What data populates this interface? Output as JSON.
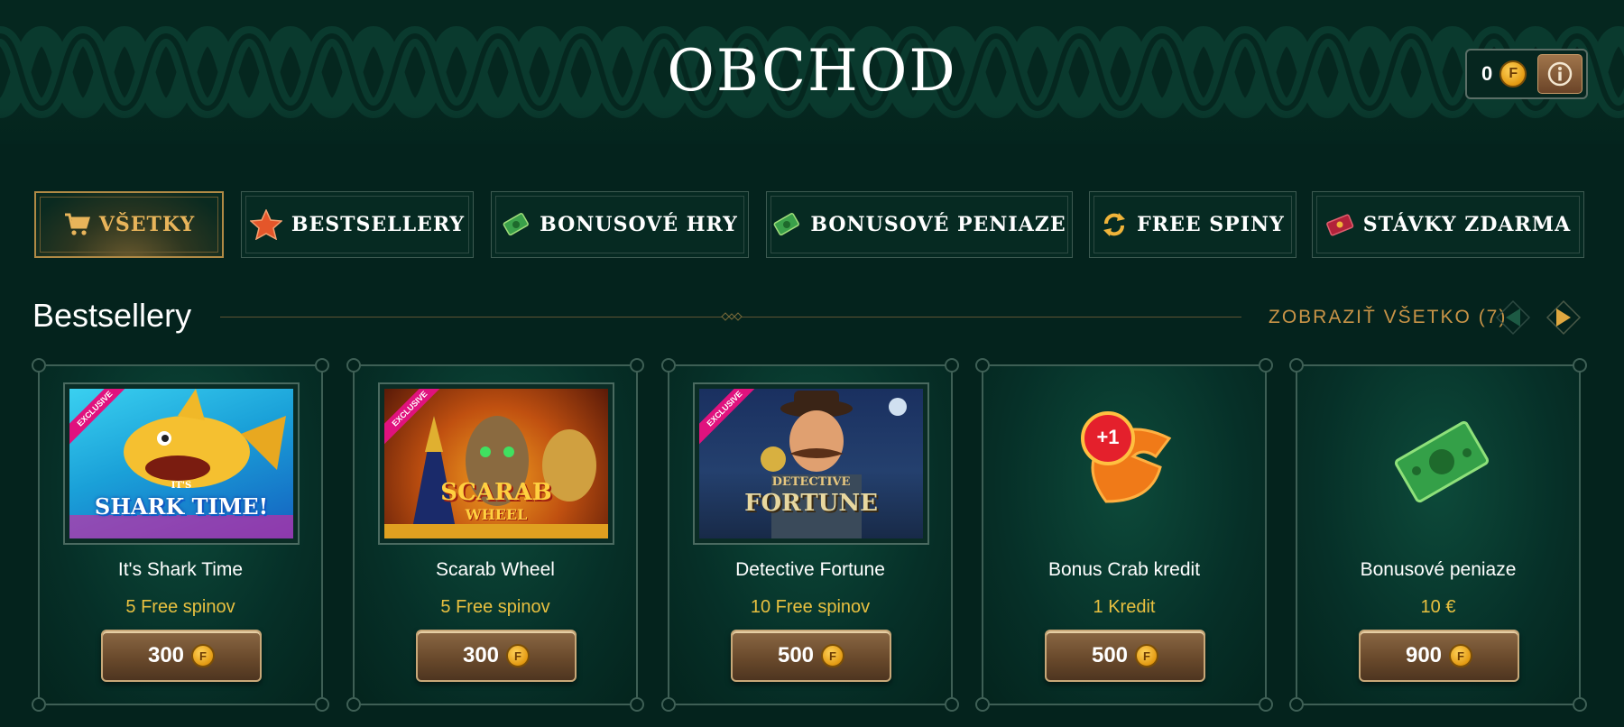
{
  "header": {
    "title": "OBCHOD",
    "balance": "0",
    "coin_symbol": "F"
  },
  "categories": [
    {
      "label": "VŠETKY",
      "icon": "cart-icon",
      "active": true
    },
    {
      "label": "BESTSELLERY",
      "icon": "star-icon",
      "active": false
    },
    {
      "label": "BONUSOVÉ HRY",
      "icon": "money-icon",
      "active": false
    },
    {
      "label": "BONUSOVÉ PENIAZE",
      "icon": "money-icon",
      "active": false
    },
    {
      "label": "FREE SPINY",
      "icon": "spin-arrows-icon",
      "active": false
    },
    {
      "label": "STÁVKY ZDARMA",
      "icon": "ticket-icon",
      "active": false
    }
  ],
  "section": {
    "title": "Bestsellery",
    "view_all": "ZOBRAZIŤ VŠETKO (7)"
  },
  "products": [
    {
      "name": "It's Shark Time",
      "subtitle": "5 Free spinov",
      "price": "300",
      "exclusive": "EXCLUSIVE",
      "image_text": "SHARK TIME!",
      "image_small": "IT'S"
    },
    {
      "name": "Scarab Wheel",
      "subtitle": "5 Free spinov",
      "price": "300",
      "exclusive": "EXCLUSIVE",
      "image_text": "SCARAB",
      "image_small": "WHEEL"
    },
    {
      "name": "Detective Fortune",
      "subtitle": "10 Free spinov",
      "price": "500",
      "exclusive": "EXCLUSIVE",
      "image_text": "FORTUNE",
      "image_small": "DETECTIVE"
    },
    {
      "name": "Bonus Crab kredit",
      "subtitle": "1 Kredit",
      "price": "500",
      "badge": "+1"
    },
    {
      "name": "Bonusové peniaze",
      "subtitle": "10 €",
      "price": "900"
    }
  ],
  "colors": {
    "background": "#04231d",
    "accent_gold": "#c99447",
    "subtitle_yellow": "#e8c040",
    "exclusive_pink": "#e0127e"
  }
}
